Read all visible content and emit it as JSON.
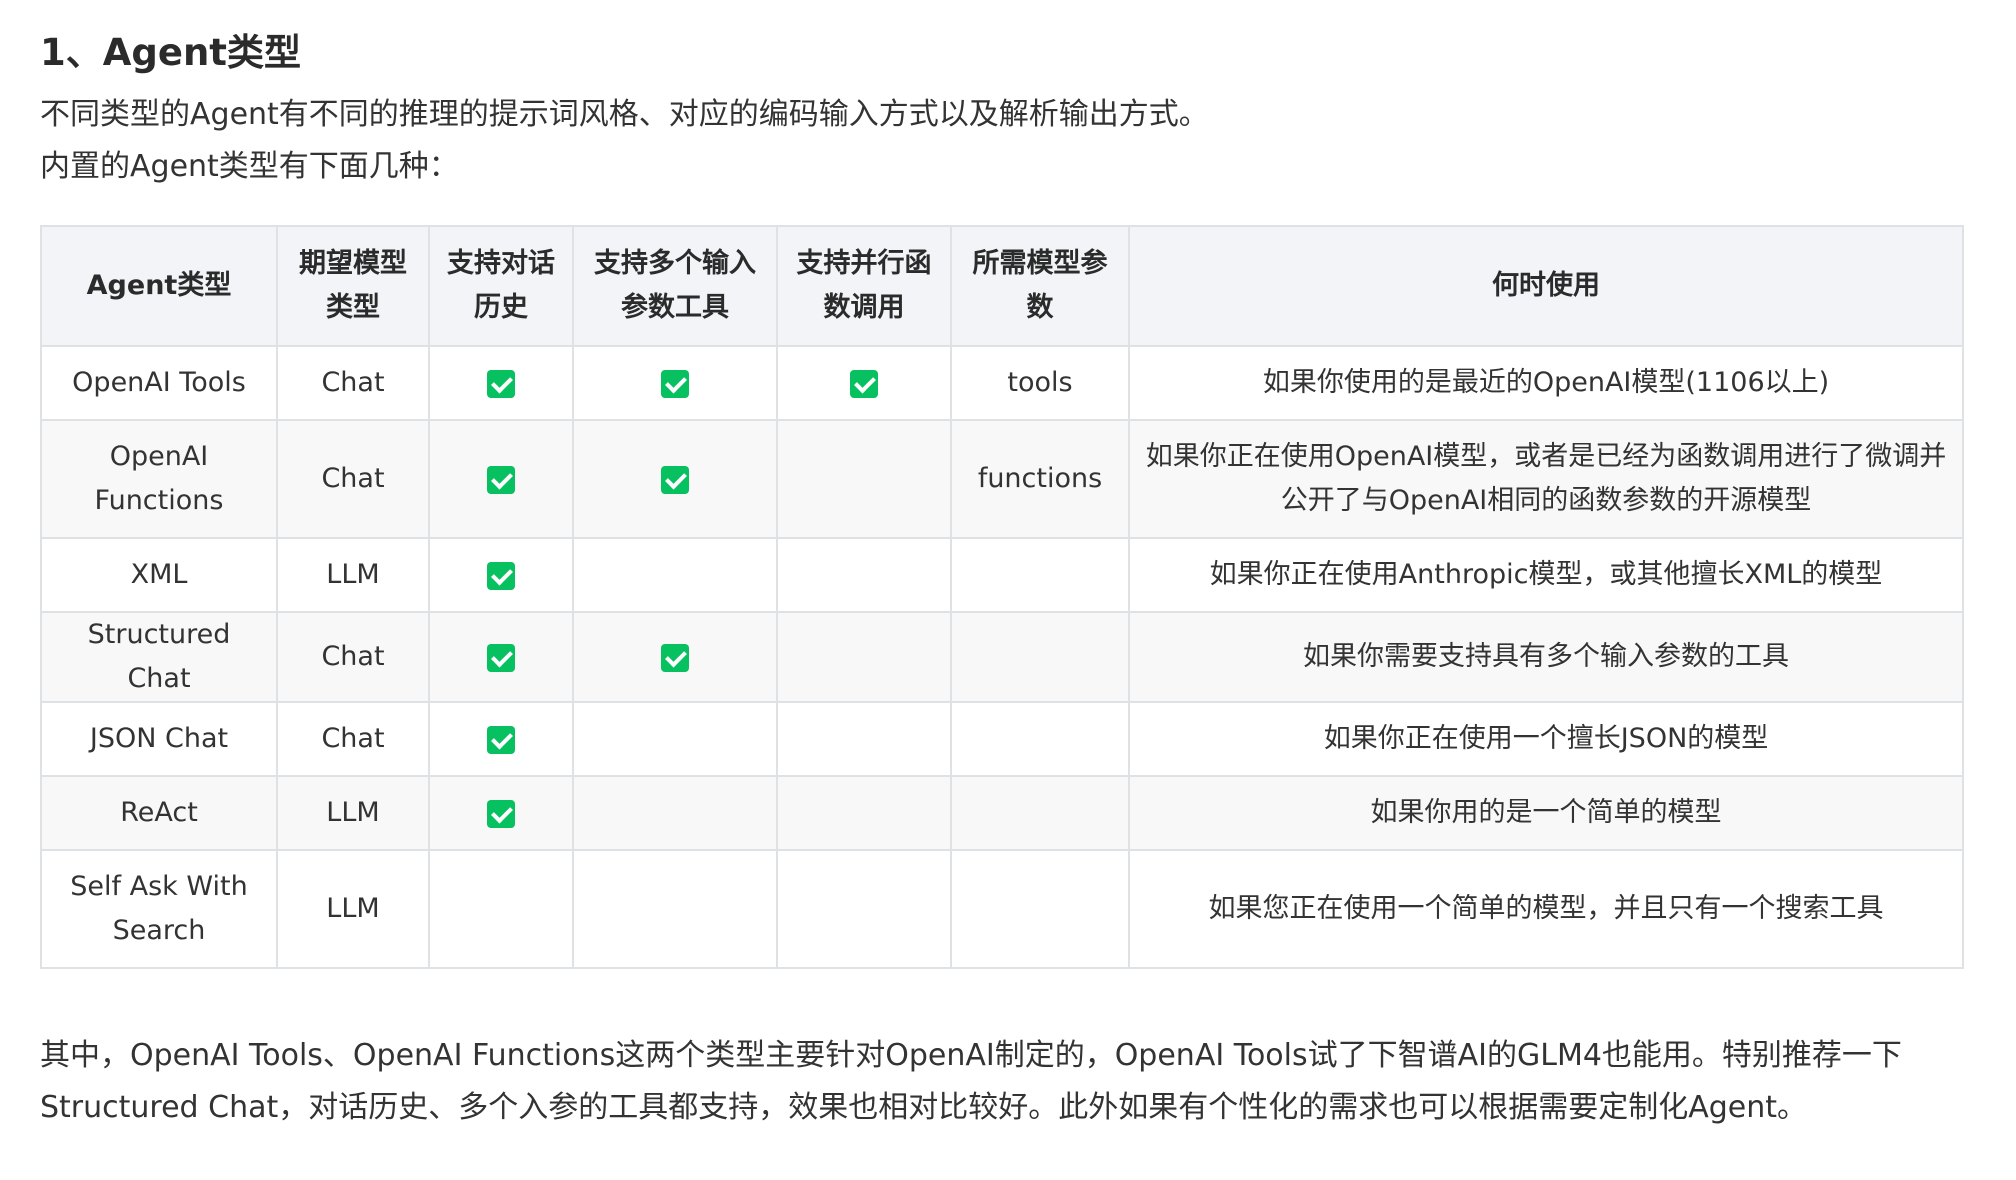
{
  "heading": "1、Agent类型",
  "intro": [
    "不同类型的Agent有不同的推理的提示词风格、对应的编码输入方式以及解析输出方式。",
    "内置的Agent类型有下面几种："
  ],
  "table": {
    "headers": [
      "Agent类型",
      "期望模型类型",
      "支持对话历史",
      "支持多个输入参数工具",
      "支持并行函数调用",
      "所需模型参数",
      "何时使用"
    ],
    "rows": [
      {
        "type": "OpenAI Tools",
        "model": "Chat",
        "history": true,
        "multi": true,
        "parallel": true,
        "params": "tools",
        "when": "如果你使用的是最近的OpenAI模型(1106以上)"
      },
      {
        "type": "OpenAI Functions",
        "model": "Chat",
        "history": true,
        "multi": true,
        "parallel": false,
        "params": "functions",
        "when": "如果你正在使用OpenAI模型，或者是已经为函数调用进行了微调并公开了与OpenAI相同的函数参数的开源模型"
      },
      {
        "type": "XML",
        "model": "LLM",
        "history": true,
        "multi": false,
        "parallel": false,
        "params": "",
        "when": "如果你正在使用Anthropic模型，或其他擅长XML的模型"
      },
      {
        "type": "Structured Chat",
        "model": "Chat",
        "history": true,
        "multi": true,
        "parallel": false,
        "params": "",
        "when": "如果你需要支持具有多个输入参数的工具"
      },
      {
        "type": "JSON Chat",
        "model": "Chat",
        "history": true,
        "multi": false,
        "parallel": false,
        "params": "",
        "when": "如果你正在使用一个擅长JSON的模型"
      },
      {
        "type": "ReAct",
        "model": "LLM",
        "history": true,
        "multi": false,
        "parallel": false,
        "params": "",
        "when": "如果你用的是一个简单的模型"
      },
      {
        "type": "Self Ask With Search",
        "model": "LLM",
        "history": false,
        "multi": false,
        "parallel": false,
        "params": "",
        "when": "如果您正在使用一个简单的模型，并且只有一个搜索工具"
      }
    ]
  },
  "check_icon_color": "#07c160",
  "footer": "其中，OpenAI Tools、OpenAI Functions这两个类型主要针对OpenAI制定的，OpenAI Tools试了下智谱AI的GLM4也能用。特别推荐一下Structured Chat，对话历史、多个入参的工具都支持，效果也相对比较好。此外如果有个性化的需求也可以根据需要定制化Agent。"
}
